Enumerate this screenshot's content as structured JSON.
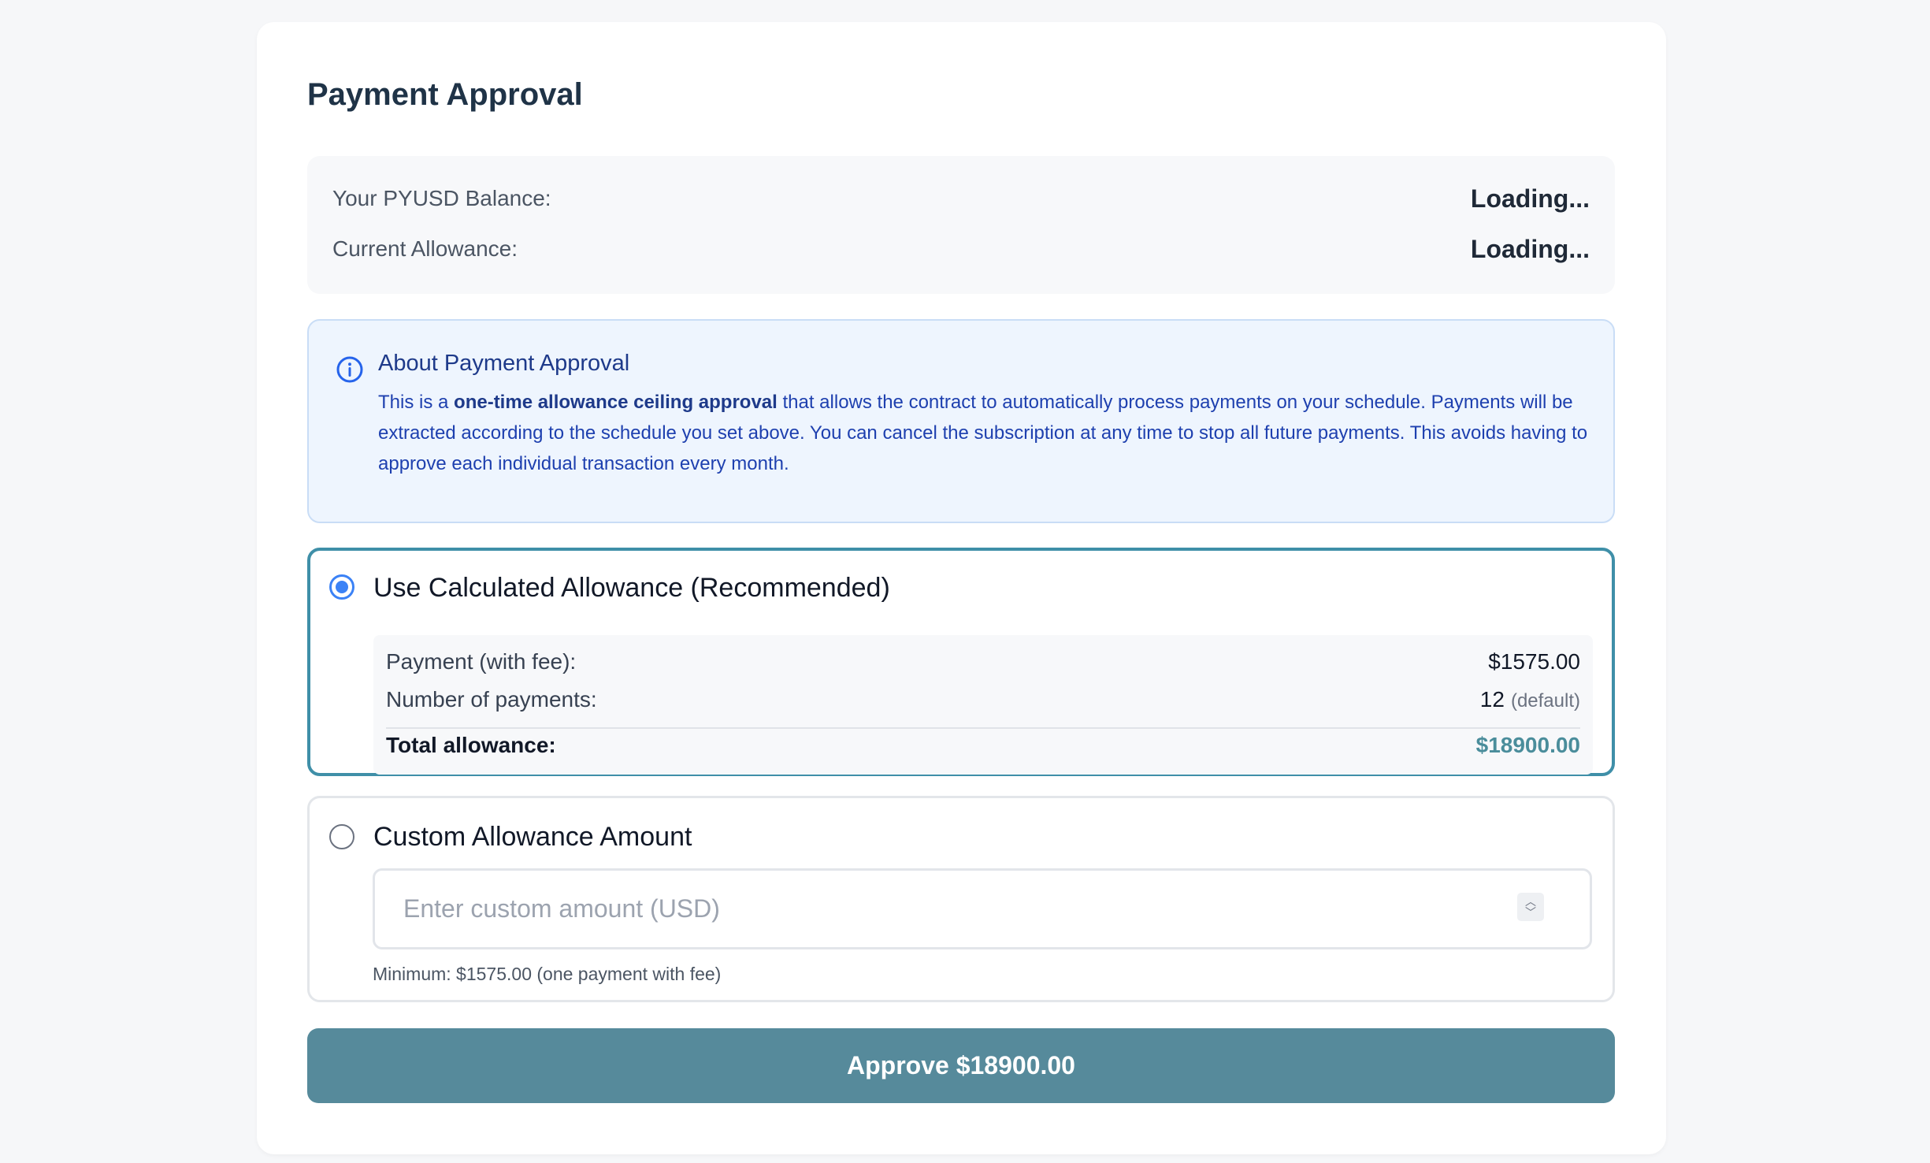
{
  "title": "Payment Approval",
  "balances": {
    "pyusd_label": "Your PYUSD Balance:",
    "pyusd_value": "Loading...",
    "allowance_label": "Current Allowance:",
    "allowance_value": "Loading..."
  },
  "info": {
    "icon": "info-circle-icon",
    "title": "About Payment Approval",
    "text_before": "This is a ",
    "text_bold": "one-time allowance ceiling approval",
    "text_after": " that allows the contract to automatically process payments on your schedule. Payments will be extracted according to the schedule you set above. You can cancel the subscription at any time to stop all future payments. This avoids having to approve each individual transaction every month."
  },
  "options": {
    "calculated": {
      "label": "Use Calculated Allowance (Recommended)",
      "selected": true,
      "payment_label": "Payment (with fee):",
      "payment_value": "$1575.00",
      "count_label": "Number of payments:",
      "count_value": "12",
      "count_note": "(default)",
      "total_label": "Total allowance:",
      "total_value": "$18900.00"
    },
    "custom": {
      "label": "Custom Allowance Amount",
      "selected": false,
      "placeholder": "Enter custom amount (USD)",
      "value": "",
      "minimum_text": "Minimum: $1575.00 (one payment with fee)"
    }
  },
  "approve_button": "Approve $18900.00",
  "colors": {
    "accent": "#568a9b",
    "selected_border": "#3f8fa8",
    "radio": "#3b82f6",
    "total": "#4a8d9b",
    "info_bg": "#eef5fe"
  }
}
